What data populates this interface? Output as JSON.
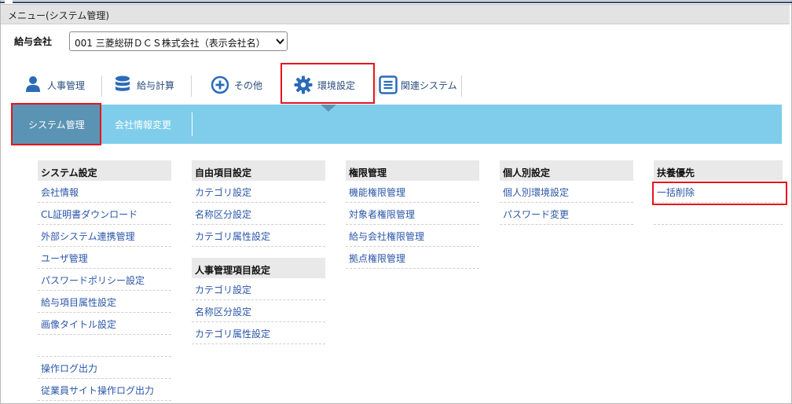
{
  "menu_title": "メニュー(システム管理)",
  "company": {
    "label": "給与会社",
    "selected": "001 三菱総研ＤＣＳ株式会社（表示会社名）"
  },
  "nav": [
    {
      "label": "人事管理",
      "icon": "person-icon"
    },
    {
      "label": "給与計算",
      "icon": "database-icon"
    },
    {
      "label": "その他",
      "icon": "plus-circle-icon"
    },
    {
      "label": "環境設定",
      "icon": "gear-icon"
    },
    {
      "label": "関連システム",
      "icon": "list-icon"
    }
  ],
  "subtabs": [
    "システム管理",
    "会社情報変更"
  ],
  "columns": [
    {
      "groups": [
        {
          "title": "システム設定",
          "items": [
            "会社情報",
            "CL証明書ダウンロード",
            "外部システム連携管理",
            "ユーザ管理",
            "パスワードポリシー設定",
            "給与項目属性設定",
            "画像タイトル設定",
            "",
            "操作ログ出力",
            "従業員サイト操作ログ出力"
          ]
        }
      ]
    },
    {
      "groups": [
        {
          "title": "自由項目設定",
          "items": [
            "カテゴリ設定",
            "名称区分設定",
            "カテゴリ属性設定"
          ]
        },
        {
          "title": "人事管理項目設定",
          "items": [
            "カテゴリ設定",
            "名称区分設定",
            "カテゴリ属性設定"
          ]
        }
      ]
    },
    {
      "groups": [
        {
          "title": "権限管理",
          "items": [
            "機能権限管理",
            "対象者権限管理",
            "給与会社権限管理",
            "拠点権限管理"
          ]
        }
      ]
    },
    {
      "groups": [
        {
          "title": "個人別設定",
          "items": [
            "個人別環境設定",
            "パスワード変更"
          ]
        }
      ]
    },
    {
      "groups": [
        {
          "title": "扶養優先",
          "items": [
            "一括削除",
            ""
          ]
        }
      ]
    }
  ],
  "colors": {
    "highlight_border": "#e8141b",
    "subbar": "#7fcdeb",
    "subtab_active": "#5a93b3",
    "link": "#2a56a8",
    "nav_icon": "#2a6bb8"
  }
}
